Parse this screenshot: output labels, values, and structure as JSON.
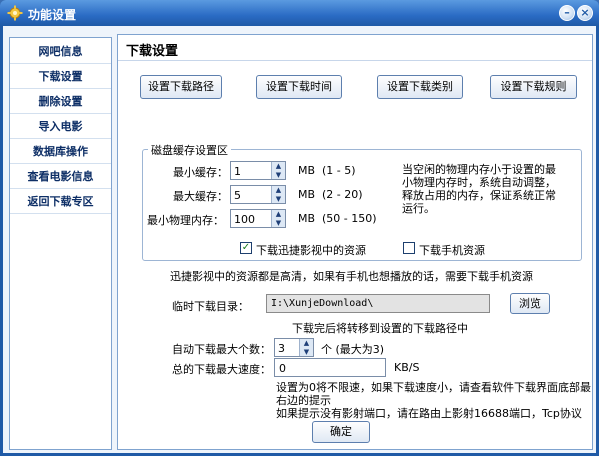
{
  "window": {
    "title": "功能设置"
  },
  "sidebar": {
    "items": [
      {
        "label": "网吧信息"
      },
      {
        "label": "下载设置"
      },
      {
        "label": "删除设置"
      },
      {
        "label": "导入电影"
      },
      {
        "label": "数据库操作"
      },
      {
        "label": "查看电影信息"
      },
      {
        "label": "返回下载专区"
      }
    ]
  },
  "panel": {
    "title": "下载设置",
    "top_buttons": {
      "path": "设置下载路径",
      "time": "设置下载时间",
      "category": "设置下载类别",
      "rule": "设置下载规则"
    },
    "cache": {
      "group_title": "磁盘缓存设置区",
      "min_cache_label": "最小缓存：",
      "min_cache_value": "1",
      "min_cache_unit": "MB",
      "min_cache_range": "(1 - 5)",
      "max_cache_label": "最大缓存：",
      "max_cache_value": "5",
      "max_cache_unit": "MB",
      "max_cache_range": "(2 - 20)",
      "min_mem_label": "最小物理内存：",
      "min_mem_value": "100",
      "min_mem_unit": "MB",
      "min_mem_range": "(50 - 150)",
      "note_line1": "当空闲的物理内存小于设置的最",
      "note_line2": "小物理内存时，系统自动调整，",
      "note_line3": "释放占用的内存，保证系统正常",
      "note_line4": "运行。"
    },
    "checks": {
      "xunjie_label": "下载迅捷影视中的资源",
      "xunjie_checked": true,
      "mobile_label": "下载手机资源",
      "mobile_checked": false
    },
    "hint_text": "迅捷影视中的资源都是高清，如果有手机也想播放的话，需要下载手机资源",
    "temp_dir": {
      "label": "临时下载目录：",
      "value": "I:\\XunjeDownload\\",
      "browse_label": "浏览",
      "note": "下载完后将转移到设置的下载路径中"
    },
    "auto_download": {
      "label": "自动下载最大个数：",
      "value": "3",
      "suffix": "个 (最大为3)"
    },
    "speed": {
      "label": "总的下载最大速度：",
      "value": "0",
      "unit": "KB/S",
      "note_line1": "设置为0将不限速，如果下载速度小，请查看软件下载界面底部最",
      "note_line2": "右边的提示",
      "note_line3": "如果提示没有影射端口，请在路由上影射16688端口，Tcp协议"
    },
    "ok_label": "确定"
  }
}
